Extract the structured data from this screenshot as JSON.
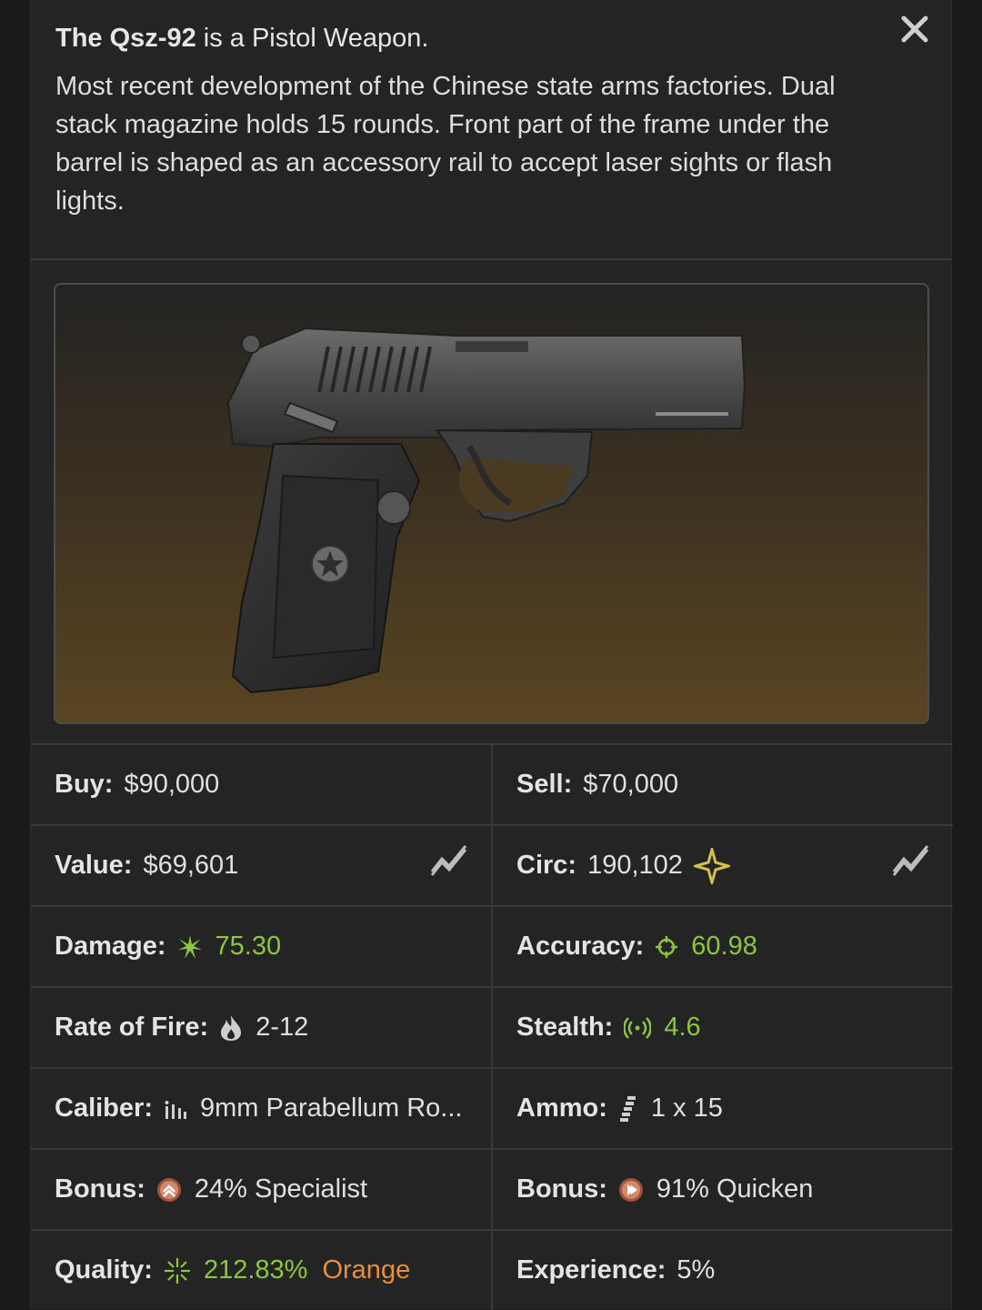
{
  "header": {
    "title_name": "The Qsz-92",
    "title_rest": " is a Pistol Weapon.",
    "description": "Most recent development of the Chinese state arms factories. Dual stack magazine holds 15 rounds. Front part of the frame under the barrel is shaped as an accessory rail to accept laser sights or flash lights."
  },
  "image": {
    "alt": "Qsz-92 pistol"
  },
  "stats": {
    "buy": {
      "label": "Buy:",
      "value": "$90,000"
    },
    "sell": {
      "label": "Sell:",
      "value": "$70,000"
    },
    "value": {
      "label": "Value:",
      "value": "$69,601"
    },
    "circ": {
      "label": "Circ:",
      "value": "190,102"
    },
    "damage": {
      "label": "Damage:",
      "value": "75.30"
    },
    "accuracy": {
      "label": "Accuracy:",
      "value": "60.98"
    },
    "rate_of_fire": {
      "label": "Rate of Fire:",
      "value": "2-12"
    },
    "stealth": {
      "label": "Stealth:",
      "value": "4.6"
    },
    "caliber": {
      "label": "Caliber:",
      "value": "9mm Parabellum Ro..."
    },
    "ammo": {
      "label": "Ammo:",
      "value": "1 x 15"
    },
    "bonus1": {
      "label": "Bonus:",
      "value": "24% Specialist"
    },
    "bonus2": {
      "label": "Bonus:",
      "value": "91% Quicken"
    },
    "quality": {
      "label": "Quality:",
      "value": "212.83%",
      "tier": "Orange"
    },
    "experience": {
      "label": "Experience:",
      "value": "5%"
    }
  },
  "colors": {
    "accent_green": "#8dc63f",
    "accent_orange": "#e8903a",
    "panel": "#242424"
  },
  "icons": [
    "close-icon",
    "trend-icon",
    "circ-star-icon",
    "damage-icon",
    "accuracy-icon",
    "fire-icon",
    "stealth-icon",
    "caliber-icon",
    "ammo-icon",
    "specialist-icon",
    "quicken-icon",
    "quality-icon"
  ]
}
